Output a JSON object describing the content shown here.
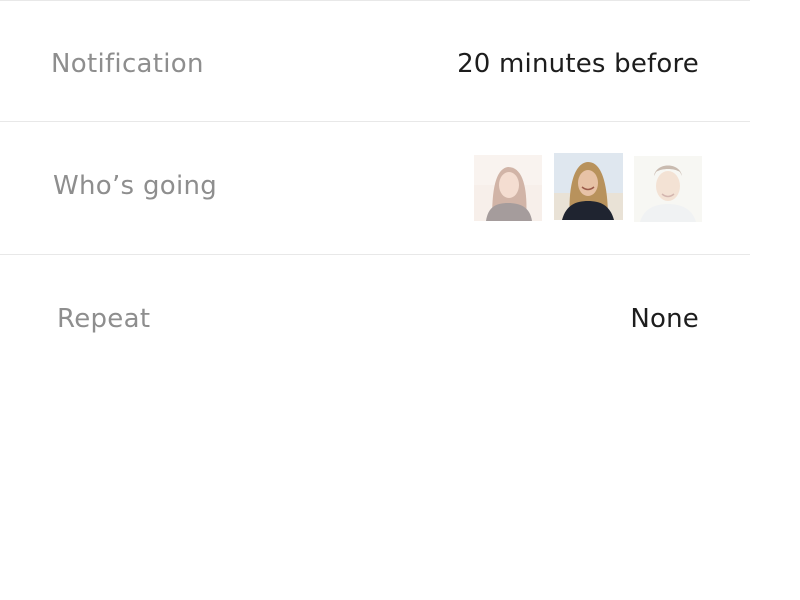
{
  "settings": {
    "notification": {
      "label": "Notification",
      "value": "20 minutes before"
    },
    "whos_going": {
      "label": "Who’s going",
      "attendees": [
        {
          "avatar": "attendee-1-avatar",
          "state": "faded"
        },
        {
          "avatar": "attendee-2-avatar",
          "state": "active"
        },
        {
          "avatar": "attendee-3-avatar",
          "state": "faded"
        }
      ]
    },
    "repeat": {
      "label": "Repeat",
      "value": "None"
    }
  },
  "colors": {
    "background": "#ffffff",
    "label_text": "#8e8e8e",
    "value_text": "#1d1d1d",
    "divider": "#e8e8e8"
  }
}
